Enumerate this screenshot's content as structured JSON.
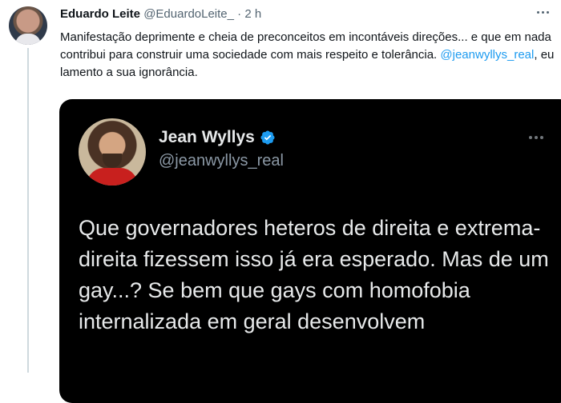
{
  "tweet": {
    "author_name": "Eduardo Leite",
    "author_handle": "@EduardoLeite_",
    "separator": "·",
    "time": "2 h",
    "text_before_mention": "Manifestação deprimente e cheia de preconceitos em incontáveis direções... e que em nada contribui para construir uma sociedade com mais respeito e tolerância.  ",
    "mention": "@jeanwyllys_real",
    "text_after_mention": ", eu lamento a sua ignorância.",
    "avatar_icon": "avatar-eduardo",
    "more_icon": "more-horizontal-icon"
  },
  "quote": {
    "author_name": "Jean Wyllys",
    "author_handle": "@jeanwyllys_real",
    "verified": true,
    "verified_color": "#1d9bf0",
    "text": "Que governadores heteros de direita e extrema-direita fizessem isso já era esperado. Mas de um gay...? Se bem que gays com homofobia internalizada em geral desenvolvem",
    "background_color": "#000000",
    "more_icon": "more-horizontal-icon"
  },
  "colors": {
    "link": "#1d9bf0",
    "secondary_text": "#536471",
    "thread_line": "#cfd9de"
  }
}
